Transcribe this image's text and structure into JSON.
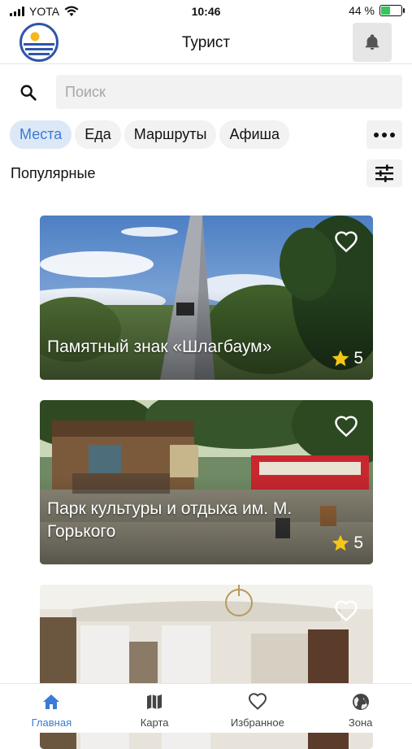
{
  "status_bar": {
    "carrier": "YOTA",
    "time": "10:46",
    "battery": "44 %",
    "battery_level": 0.44
  },
  "header": {
    "title": "Турист",
    "logo_icon": "sun-over-sea-logo",
    "bell_icon": "bell-icon"
  },
  "search": {
    "placeholder": "Поиск",
    "value": ""
  },
  "tabs": [
    {
      "label": "Места",
      "active": true
    },
    {
      "label": "Еда",
      "active": false
    },
    {
      "label": "Маршруты",
      "active": false
    },
    {
      "label": "Афиша",
      "active": false
    }
  ],
  "section": {
    "title": "Популярные"
  },
  "places": [
    {
      "name": "Памятный знак «Шлагбаум»",
      "rating": "5"
    },
    {
      "name": "Парк культуры и отдыха им. М. Горького",
      "rating": "5"
    },
    {
      "name": "",
      "rating": ""
    }
  ],
  "nav": [
    {
      "label": "Главная",
      "icon": "home-icon",
      "active": true
    },
    {
      "label": "Карта",
      "icon": "map-icon",
      "active": false
    },
    {
      "label": "Избранное",
      "icon": "heart-icon",
      "active": false
    },
    {
      "label": "Зона",
      "icon": "globe-icon",
      "active": false
    }
  ],
  "colors": {
    "accent": "#3a7bd5",
    "star": "#f5c518",
    "chip_bg": "#f2f2f2",
    "active_chip_bg": "#dde8f6"
  }
}
